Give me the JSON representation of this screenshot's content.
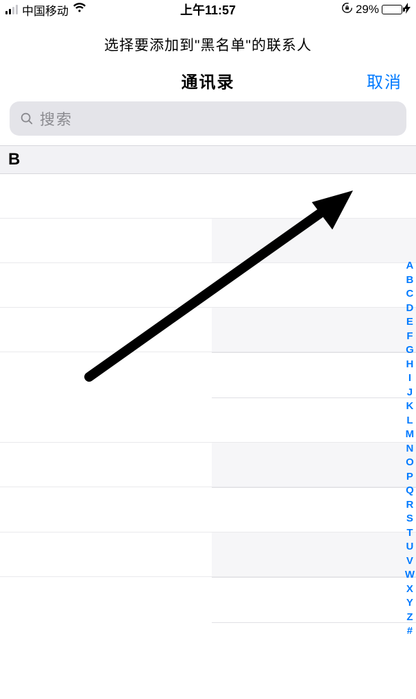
{
  "status": {
    "carrier": "中国移动",
    "time": "上午11:57",
    "battery_pct": "29%"
  },
  "prompt": "选择要添加到\"黑名单\"的联系人",
  "nav": {
    "title": "通讯录",
    "cancel": "取消"
  },
  "search": {
    "placeholder": "搜索"
  },
  "section": {
    "letter": "B"
  },
  "index": [
    "A",
    "B",
    "C",
    "D",
    "E",
    "F",
    "G",
    "H",
    "I",
    "J",
    "K",
    "L",
    "M",
    "N",
    "O",
    "P",
    "Q",
    "R",
    "S",
    "T",
    "U",
    "V",
    "W",
    "X",
    "Y",
    "Z",
    "#"
  ]
}
